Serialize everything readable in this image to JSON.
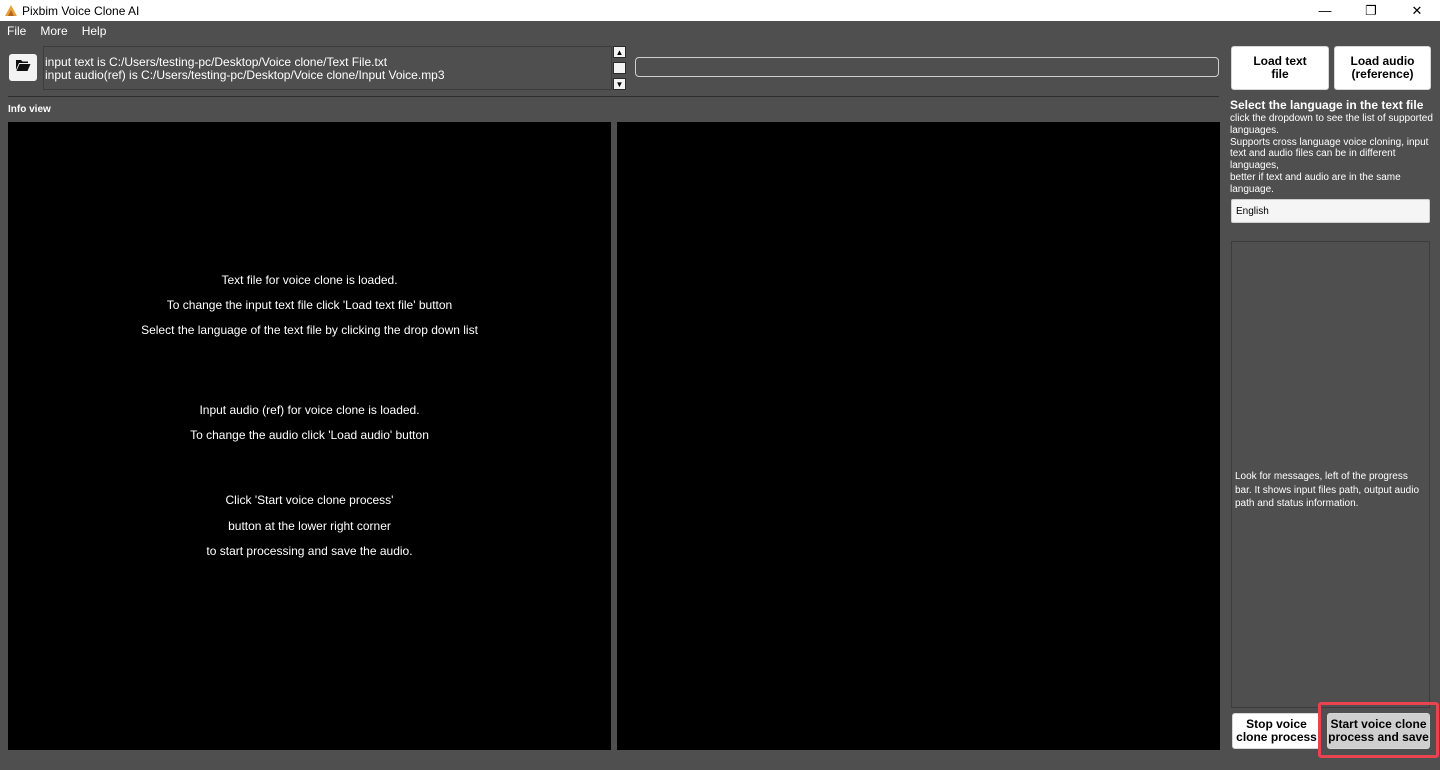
{
  "window": {
    "title": "Pixbim Voice Clone AI",
    "controls": {
      "minimize": "—",
      "restore": "❐",
      "close": "✕"
    }
  },
  "menu": [
    "File",
    "More",
    "Help"
  ],
  "toolbar": {
    "open_icon": "folder-open-icon",
    "info_lines": [
      "input text is C:/Users/testing-pc/Desktop/Voice clone/Text File.txt",
      "input audio(ref) is C:/Users/testing-pc/Desktop/Voice clone/Input Voice.mp3"
    ],
    "progress_fraction": 0
  },
  "info_view": {
    "label": "Info view",
    "lines": [
      "Text file for voice clone is loaded.",
      "To change the input text file click 'Load text file' button",
      "Select the language of the text file by clicking the drop down list",
      "Input audio (ref) for voice clone is loaded.",
      "To change the audio click 'Load audio' button",
      "Click 'Start voice clone process'",
      "button at the lower right corner",
      "to start processing and save the audio."
    ]
  },
  "right_panel": {
    "load_text_label": [
      "Load text",
      "file"
    ],
    "load_audio_label": [
      "Load audio",
      "(reference)"
    ],
    "language_heading": "Select the language in the text file",
    "language_help": [
      "click the dropdown to see the list of supported",
      "languages.",
      "Supports cross language voice cloning, input",
      "text and audio files can be in different",
      "languages,",
      "better if text and audio are in the same",
      "language."
    ],
    "language_selected": "English",
    "message_help": "Look for messages, left of the progress bar. It shows input files path, output audio path and status information.",
    "stop_label": [
      "Stop voice",
      "clone process"
    ],
    "start_label": [
      "Start voice clone",
      "process and save"
    ]
  },
  "colors": {
    "background": "#4f4f4f",
    "panel": "#000000",
    "highlight": "#e8434f"
  }
}
